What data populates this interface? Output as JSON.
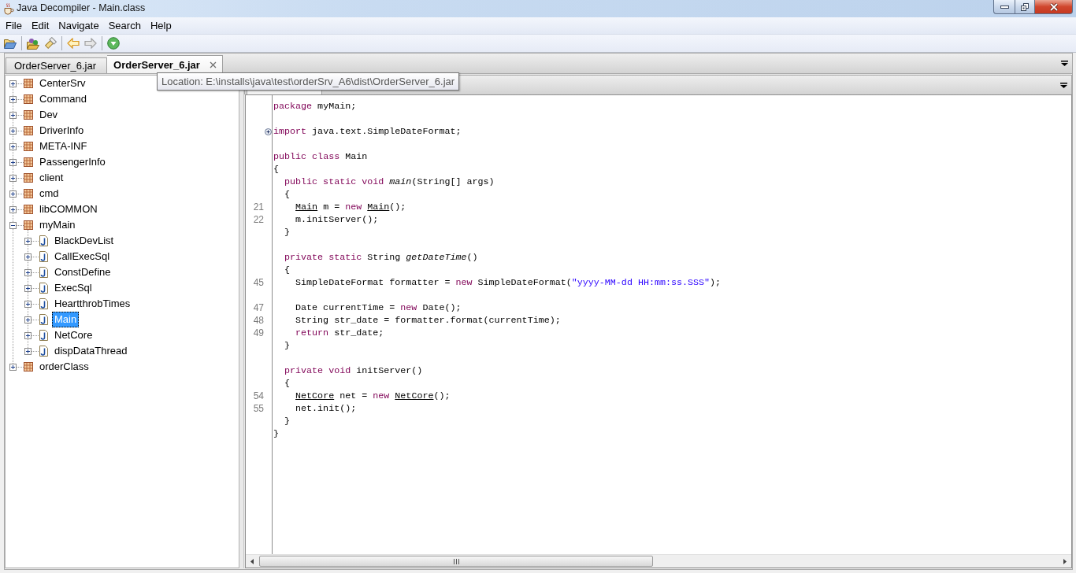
{
  "window": {
    "title": "Java Decompiler - Main.class"
  },
  "menu": [
    "File",
    "Edit",
    "Navigate",
    "Search",
    "Help"
  ],
  "toolbar": {
    "back_button": {
      "disabled": false
    },
    "forward_button": {
      "disabled": true
    }
  },
  "tabs": [
    {
      "label": "OrderServer_6.jar",
      "selected": false
    },
    {
      "label": "OrderServer_6.jar",
      "selected": true
    }
  ],
  "tooltip": {
    "text": "Location: E:\\installs\\java\\test\\orderSrv_A6\\dist\\OrderServer_6.jar"
  },
  "tree": [
    {
      "label": "CenterSrv",
      "kind": "package",
      "expanded": false,
      "selected": false
    },
    {
      "label": "Command",
      "kind": "package",
      "expanded": false,
      "selected": false
    },
    {
      "label": "Dev",
      "kind": "package",
      "expanded": false,
      "selected": false
    },
    {
      "label": "DriverInfo",
      "kind": "package",
      "expanded": false,
      "selected": false
    },
    {
      "label": "META-INF",
      "kind": "package",
      "expanded": false,
      "selected": false
    },
    {
      "label": "PassengerInfo",
      "kind": "package",
      "expanded": false,
      "selected": false
    },
    {
      "label": "client",
      "kind": "package",
      "expanded": false,
      "selected": false
    },
    {
      "label": "cmd",
      "kind": "package",
      "expanded": false,
      "selected": false
    },
    {
      "label": "libCOMMON",
      "kind": "package",
      "expanded": false,
      "selected": false
    },
    {
      "label": "myMain",
      "kind": "package",
      "expanded": true,
      "selected": false,
      "children": [
        {
          "label": "BlackDevList",
          "kind": "class",
          "expanded": false,
          "selected": false
        },
        {
          "label": "CallExecSql",
          "kind": "class",
          "expanded": false,
          "selected": false
        },
        {
          "label": "ConstDefine",
          "kind": "class",
          "expanded": false,
          "selected": false
        },
        {
          "label": "ExecSql",
          "kind": "class",
          "expanded": false,
          "selected": false
        },
        {
          "label": "HeartthrobTimes",
          "kind": "class",
          "expanded": false,
          "selected": false
        },
        {
          "label": "Main",
          "kind": "class",
          "expanded": false,
          "selected": true
        },
        {
          "label": "NetCore",
          "kind": "class",
          "expanded": false,
          "selected": false
        },
        {
          "label": "dispDataThread",
          "kind": "class",
          "expanded": false,
          "selected": false
        }
      ]
    },
    {
      "label": "orderClass",
      "kind": "package",
      "expanded": false,
      "selected": false
    }
  ],
  "editor": {
    "lines": [
      {
        "kind": "code",
        "collapsed": false,
        "tokens": [
          {
            "text": "package",
            "kind": "keyword"
          },
          {
            "text": " myMain;",
            "kind": "plain"
          }
        ]
      },
      {
        "kind": "blank"
      },
      {
        "kind": "code",
        "collapsed": true,
        "tokens": [
          {
            "text": "import",
            "kind": "keyword"
          },
          {
            "text": " java.text.SimpleDateFormat;",
            "kind": "plain"
          }
        ]
      },
      {
        "kind": "blank"
      },
      {
        "kind": "code",
        "collapsed": false,
        "tokens": [
          {
            "text": "public",
            "kind": "keyword"
          },
          {
            "text": " class",
            "kind": "keyword"
          },
          {
            "text": " Main",
            "kind": "plain"
          }
        ]
      },
      {
        "kind": "code",
        "collapsed": false,
        "tokens": [
          {
            "text": "{",
            "kind": "plain"
          }
        ]
      },
      {
        "kind": "code",
        "collapsed": false,
        "tokens": [
          {
            "text": "  public",
            "kind": "keyword"
          },
          {
            "text": " static",
            "kind": "keyword"
          },
          {
            "text": " void",
            "kind": "keyword"
          },
          {
            "text": " main",
            "kind": "italic"
          },
          {
            "text": "(String[] args)",
            "kind": "plain"
          }
        ]
      },
      {
        "kind": "code",
        "collapsed": false,
        "tokens": [
          {
            "text": "  {",
            "kind": "plain"
          }
        ]
      },
      {
        "kind": "code",
        "number": "21",
        "collapsed": false,
        "tokens": [
          {
            "text": "    Main",
            "kind": "link"
          },
          {
            "text": " m = ",
            "kind": "plain"
          },
          {
            "text": "new",
            "kind": "keyword"
          },
          {
            "text": " Main",
            "kind": "link"
          },
          {
            "text": "();",
            "kind": "plain"
          }
        ]
      },
      {
        "kind": "code",
        "number": "22",
        "collapsed": false,
        "tokens": [
          {
            "text": "    m.initServer();",
            "kind": "plain"
          }
        ]
      },
      {
        "kind": "code",
        "collapsed": false,
        "tokens": [
          {
            "text": "  }",
            "kind": "plain"
          }
        ]
      },
      {
        "kind": "blank"
      },
      {
        "kind": "code",
        "collapsed": false,
        "tokens": [
          {
            "text": "  private",
            "kind": "keyword"
          },
          {
            "text": " static",
            "kind": "keyword"
          },
          {
            "text": " String ",
            "kind": "plain"
          },
          {
            "text": "getDateTime",
            "kind": "italic"
          },
          {
            "text": "()",
            "kind": "plain"
          }
        ]
      },
      {
        "kind": "code",
        "collapsed": false,
        "tokens": [
          {
            "text": "  {",
            "kind": "plain"
          }
        ]
      },
      {
        "kind": "code",
        "number": "45",
        "collapsed": false,
        "tokens": [
          {
            "text": "    SimpleDateFormat formatter = ",
            "kind": "plain"
          },
          {
            "text": "new",
            "kind": "keyword"
          },
          {
            "text": " SimpleDateFormat(",
            "kind": "plain"
          },
          {
            "text": "\"yyyy-MM-dd HH:mm:ss.SSS\"",
            "kind": "string"
          },
          {
            "text": ");",
            "kind": "plain"
          }
        ]
      },
      {
        "kind": "blank"
      },
      {
        "kind": "code",
        "number": "47",
        "collapsed": false,
        "tokens": [
          {
            "text": "    Date currentTime = ",
            "kind": "plain"
          },
          {
            "text": "new",
            "kind": "keyword"
          },
          {
            "text": " Date();",
            "kind": "plain"
          }
        ]
      },
      {
        "kind": "code",
        "number": "48",
        "collapsed": false,
        "tokens": [
          {
            "text": "    String str_date = formatter.format(currentTime);",
            "kind": "plain"
          }
        ]
      },
      {
        "kind": "code",
        "number": "49",
        "collapsed": false,
        "tokens": [
          {
            "text": "    return",
            "kind": "keyword"
          },
          {
            "text": " str_date;",
            "kind": "plain"
          }
        ]
      },
      {
        "kind": "code",
        "collapsed": false,
        "tokens": [
          {
            "text": "  }",
            "kind": "plain"
          }
        ]
      },
      {
        "kind": "blank"
      },
      {
        "kind": "code",
        "collapsed": false,
        "tokens": [
          {
            "text": "  private",
            "kind": "keyword"
          },
          {
            "text": " void",
            "kind": "keyword"
          },
          {
            "text": " initServer()",
            "kind": "plain"
          }
        ]
      },
      {
        "kind": "code",
        "collapsed": false,
        "tokens": [
          {
            "text": "  {",
            "kind": "plain"
          }
        ]
      },
      {
        "kind": "code",
        "number": "54",
        "collapsed": false,
        "tokens": [
          {
            "text": "    NetCore",
            "kind": "link"
          },
          {
            "text": " net = ",
            "kind": "plain"
          },
          {
            "text": "new",
            "kind": "keyword"
          },
          {
            "text": " NetCore",
            "kind": "link"
          },
          {
            "text": "();",
            "kind": "plain"
          }
        ]
      },
      {
        "kind": "code",
        "number": "55",
        "collapsed": false,
        "tokens": [
          {
            "text": "    net.init();",
            "kind": "plain"
          }
        ]
      },
      {
        "kind": "code",
        "collapsed": false,
        "tokens": [
          {
            "text": "  }",
            "kind": "plain"
          }
        ]
      },
      {
        "kind": "code",
        "collapsed": false,
        "tokens": [
          {
            "text": "}",
            "kind": "plain"
          }
        ]
      }
    ]
  }
}
